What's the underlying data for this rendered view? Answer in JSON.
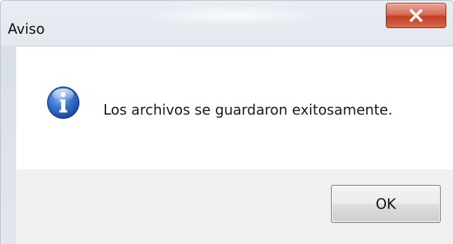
{
  "window": {
    "title": "Aviso",
    "close_icon": "close-x-icon"
  },
  "dialog": {
    "icon": "info-icon",
    "message": "Los archivos se guardaron exitosamente."
  },
  "buttons": {
    "ok_label": "OK"
  },
  "colors": {
    "close_button": "#c94a30",
    "info_icon": "#2d62b8",
    "footer": "#f0f0f0"
  }
}
